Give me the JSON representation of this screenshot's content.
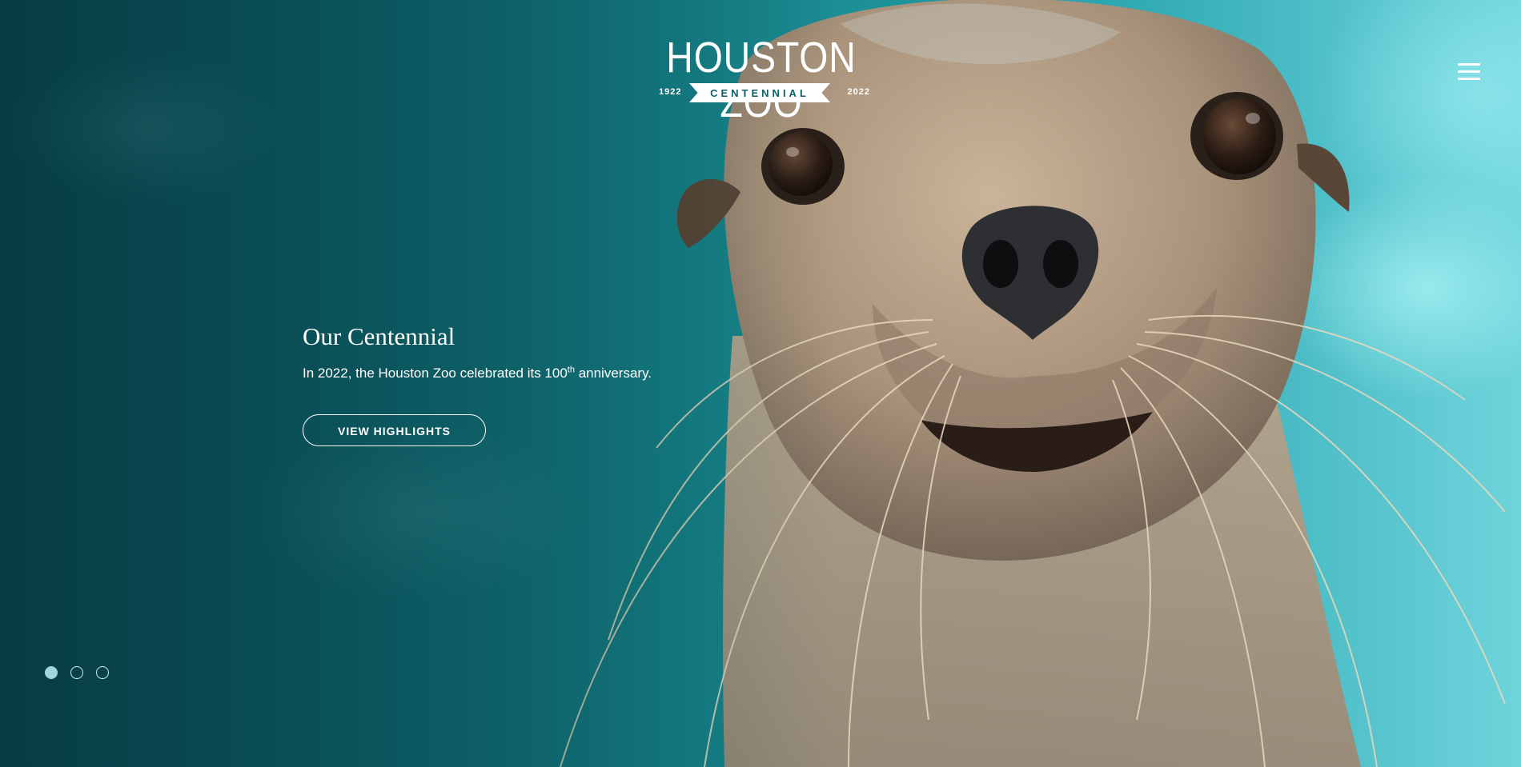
{
  "logo": {
    "name": "HOUSTON ZOO",
    "ribbon_text": "CENTENNIAL",
    "year_start": "1922",
    "year_end": "2022"
  },
  "header": {
    "menu_icon": "hamburger-menu-icon"
  },
  "hero": {
    "title": "Our Centennial",
    "text_before": "In 2022, the Houston Zoo celebrated its 100",
    "text_sup": "th",
    "text_after": " anniversary.",
    "button_label": "VIEW HIGHLIGHTS",
    "photo_subject": "sea lion close-up in turquoise water"
  },
  "slider": {
    "total_slides": 3,
    "active_index": 0
  },
  "colors": {
    "water_dark": "#0b4f57",
    "water_light": "#6fd4dc",
    "active_dot": "#9fd6e0",
    "logo_ribbon_text": "#0f5f68",
    "text": "#ffffff"
  }
}
